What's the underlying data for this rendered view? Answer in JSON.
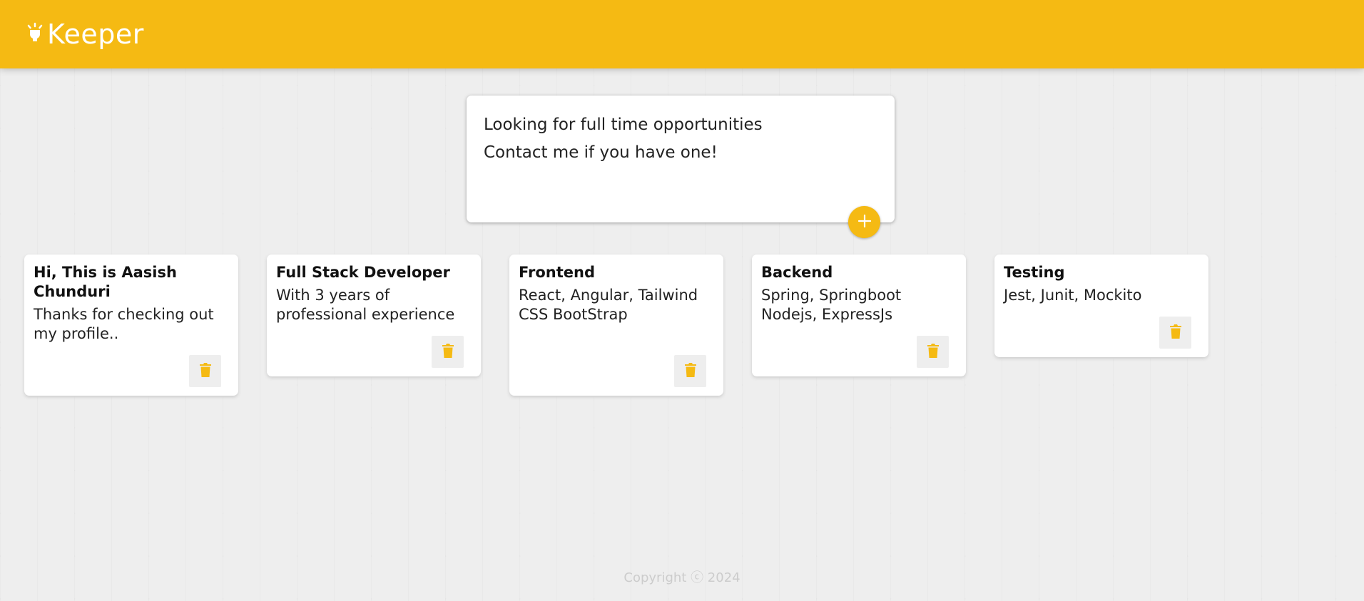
{
  "header": {
    "title": "Keeper",
    "icon": "lightbulb-icon",
    "color": "#f5ba13"
  },
  "create_note": {
    "lines": [
      "Looking for full time opportunities",
      "Contact me if you have one!"
    ],
    "add_icon": "plus-icon"
  },
  "notes": [
    {
      "title": "Hi, This is Aasish Chunduri",
      "content": "Thanks for checking out my profile..",
      "delete_icon": "trash-icon"
    },
    {
      "title": "Full Stack Developer",
      "content": "With 3 years of professional experience",
      "delete_icon": "trash-icon"
    },
    {
      "title": "Frontend",
      "content": "React, Angular, Tailwind CSS BootStrap",
      "delete_icon": "trash-icon"
    },
    {
      "title": "Backend",
      "content": "Spring, Springboot Nodejs, ExpressJs",
      "delete_icon": "trash-icon"
    },
    {
      "title": "Testing",
      "content": "Jest, Junit, Mockito",
      "delete_icon": "trash-icon"
    }
  ],
  "footer": {
    "text": "Copyright ⓒ 2024"
  }
}
